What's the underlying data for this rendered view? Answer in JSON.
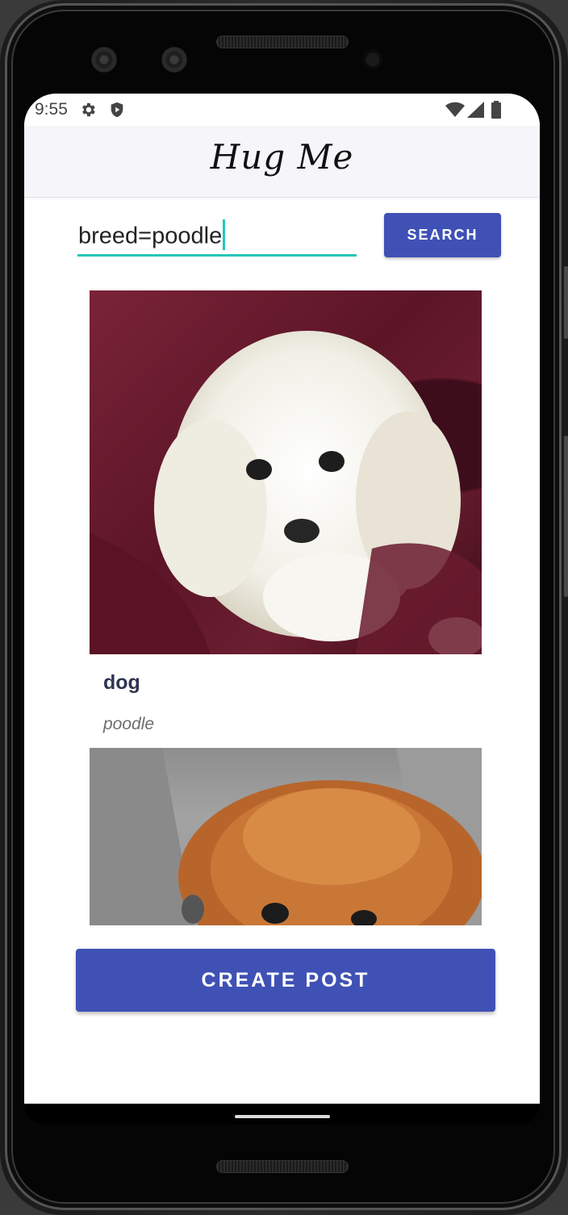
{
  "status_bar": {
    "time": "9:55",
    "left_icons": [
      "gear-icon",
      "shield-icon"
    ],
    "right_icons": [
      "wifi-icon",
      "cell-signal-icon",
      "battery-icon"
    ]
  },
  "app_bar": {
    "title": "Hug Me"
  },
  "search": {
    "value": "breed=poodle",
    "button_label": "SEARCH",
    "accent_color": "#26c6b9"
  },
  "posts": [
    {
      "title": "dog",
      "subtitle": "poodle",
      "photo": "white poodle puppy on maroon fleece"
    },
    {
      "title": "",
      "subtitle": "",
      "photo": "brown poodle peeking from grey sweater"
    }
  ],
  "actions": {
    "create_post_label": "CREATE POST"
  },
  "colors": {
    "primary": "#3f51b5",
    "app_bar_bg": "#f6f5f9",
    "title_text": "#2f3450"
  }
}
